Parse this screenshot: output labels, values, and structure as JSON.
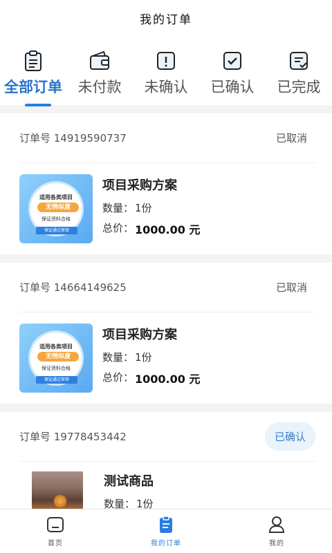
{
  "header": {
    "title": "我的订单"
  },
  "tabs": [
    {
      "label": "全部订单",
      "icon": "clipboard-icon",
      "active": true
    },
    {
      "label": "未付款",
      "icon": "wallet-icon",
      "active": false
    },
    {
      "label": "未确认",
      "icon": "alert-box-icon",
      "active": false
    },
    {
      "label": "已确认",
      "icon": "checked-box-icon",
      "active": false
    },
    {
      "label": "已完成",
      "icon": "list-check-icon",
      "active": false
    }
  ],
  "orders": [
    {
      "order_no": "订单号 14919590737",
      "status": "已取消",
      "product": "项目采购方案",
      "qty_label": "数量：",
      "qty": "1份",
      "total_label": "总价：",
      "total": "1000.00 元",
      "thumb": {
        "line1": "适用各类项目",
        "line2": "无悄似度",
        "line3": "保证资料合格",
        "ribbon": "保证通过审审"
      }
    },
    {
      "order_no": "订单号 14664149625",
      "status": "已取消",
      "product": "项目采购方案",
      "qty_label": "数量：",
      "qty": "1份",
      "total_label": "总价：",
      "total": "1000.00 元",
      "thumb": {
        "line1": "适用各类项目",
        "line2": "无悄似度",
        "line3": "保证资料合格",
        "ribbon": "保证通过审审"
      }
    },
    {
      "order_no": "订单号 19778453442",
      "status": "已确认",
      "product": "测试商品",
      "qty_label": "数量：",
      "qty": "1份"
    }
  ],
  "bottom_nav": [
    {
      "label": "首页",
      "icon": "home-icon",
      "active": false
    },
    {
      "label": "我的订单",
      "icon": "order-doc-icon",
      "active": true
    },
    {
      "label": "我的",
      "icon": "user-icon",
      "active": false
    }
  ],
  "colors": {
    "accent": "#2a7de1",
    "status_pill_bg": "#e8f3fb",
    "divider": "#f3f3f3"
  }
}
